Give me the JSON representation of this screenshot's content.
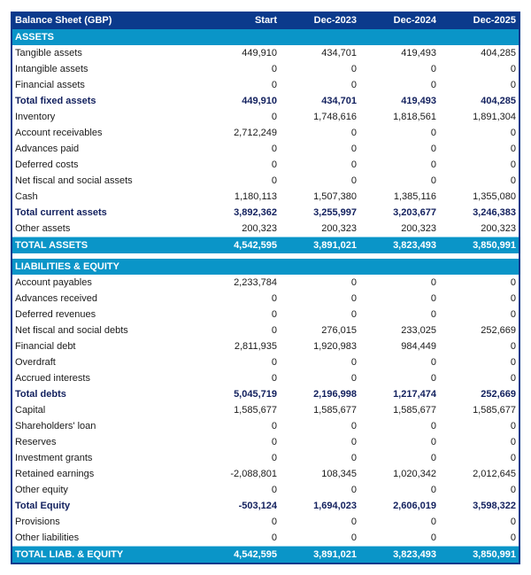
{
  "table": {
    "title": "Balance Sheet (GBP)",
    "columns": [
      "Start",
      "Dec-2023",
      "Dec-2024",
      "Dec-2025"
    ],
    "assets": {
      "section_label": "ASSETS",
      "rows": [
        {
          "label": "Tangible assets",
          "values": [
            "449,910",
            "434,701",
            "419,493",
            "404,285"
          ],
          "type": "normal"
        },
        {
          "label": "Intangible assets",
          "values": [
            "0",
            "0",
            "0",
            "0"
          ],
          "type": "normal"
        },
        {
          "label": "Financial assets",
          "values": [
            "0",
            "0",
            "0",
            "0"
          ],
          "type": "normal"
        },
        {
          "label": "Total fixed assets",
          "values": [
            "449,910",
            "434,701",
            "419,493",
            "404,285"
          ],
          "type": "subtotal"
        },
        {
          "label": "Inventory",
          "values": [
            "0",
            "1,748,616",
            "1,818,561",
            "1,891,304"
          ],
          "type": "normal"
        },
        {
          "label": "Account receivables",
          "values": [
            "2,712,249",
            "0",
            "0",
            "0"
          ],
          "type": "normal"
        },
        {
          "label": "Advances paid",
          "values": [
            "0",
            "0",
            "0",
            "0"
          ],
          "type": "normal"
        },
        {
          "label": "Deferred costs",
          "values": [
            "0",
            "0",
            "0",
            "0"
          ],
          "type": "normal"
        },
        {
          "label": "Net fiscal and social assets",
          "values": [
            "0",
            "0",
            "0",
            "0"
          ],
          "type": "normal"
        },
        {
          "label": "Cash",
          "values": [
            "1,180,113",
            "1,507,380",
            "1,385,116",
            "1,355,080"
          ],
          "type": "normal"
        },
        {
          "label": "Total current assets",
          "values": [
            "3,892,362",
            "3,255,997",
            "3,203,677",
            "3,246,383"
          ],
          "type": "subtotal"
        },
        {
          "label": "Other assets",
          "values": [
            "200,323",
            "200,323",
            "200,323",
            "200,323"
          ],
          "type": "normal"
        }
      ],
      "total": {
        "label": "TOTAL ASSETS",
        "values": [
          "4,542,595",
          "3,891,021",
          "3,823,493",
          "3,850,991"
        ]
      }
    },
    "liabilities": {
      "section_label": "LIABILITIES & EQUITY",
      "rows": [
        {
          "label": "Account payables",
          "values": [
            "2,233,784",
            "0",
            "0",
            "0"
          ],
          "type": "normal"
        },
        {
          "label": "Advances received",
          "values": [
            "0",
            "0",
            "0",
            "0"
          ],
          "type": "normal"
        },
        {
          "label": "Deferred revenues",
          "values": [
            "0",
            "0",
            "0",
            "0"
          ],
          "type": "normal"
        },
        {
          "label": "Net fiscal and social debts",
          "values": [
            "0",
            "276,015",
            "233,025",
            "252,669"
          ],
          "type": "normal"
        },
        {
          "label": "Financial debt",
          "values": [
            "2,811,935",
            "1,920,983",
            "984,449",
            "0"
          ],
          "type": "normal"
        },
        {
          "label": "Overdraft",
          "values": [
            "0",
            "0",
            "0",
            "0"
          ],
          "type": "normal"
        },
        {
          "label": "Accrued interests",
          "values": [
            "0",
            "0",
            "0",
            "0"
          ],
          "type": "normal"
        },
        {
          "label": "Total debts",
          "values": [
            "5,045,719",
            "2,196,998",
            "1,217,474",
            "252,669"
          ],
          "type": "subtotal"
        },
        {
          "label": "Capital",
          "values": [
            "1,585,677",
            "1,585,677",
            "1,585,677",
            "1,585,677"
          ],
          "type": "normal"
        },
        {
          "label": "Shareholders' loan",
          "values": [
            "0",
            "0",
            "0",
            "0"
          ],
          "type": "normal"
        },
        {
          "label": "Reserves",
          "values": [
            "0",
            "0",
            "0",
            "0"
          ],
          "type": "normal"
        },
        {
          "label": "Investment grants",
          "values": [
            "0",
            "0",
            "0",
            "0"
          ],
          "type": "normal"
        },
        {
          "label": "Retained earnings",
          "values": [
            "-2,088,801",
            "108,345",
            "1,020,342",
            "2,012,645"
          ],
          "type": "normal"
        },
        {
          "label": "Other equity",
          "values": [
            "0",
            "0",
            "0",
            "0"
          ],
          "type": "normal"
        },
        {
          "label": "Total Equity",
          "values": [
            "-503,124",
            "1,694,023",
            "2,606,019",
            "3,598,322"
          ],
          "type": "subtotal"
        },
        {
          "label": "Provisions",
          "values": [
            "0",
            "0",
            "0",
            "0"
          ],
          "type": "normal"
        },
        {
          "label": "Other liabilities",
          "values": [
            "0",
            "0",
            "0",
            "0"
          ],
          "type": "normal"
        }
      ],
      "total": {
        "label": "TOTAL LIAB. & EQUITY",
        "values": [
          "4,542,595",
          "3,891,021",
          "3,823,493",
          "3,850,991"
        ]
      }
    }
  }
}
